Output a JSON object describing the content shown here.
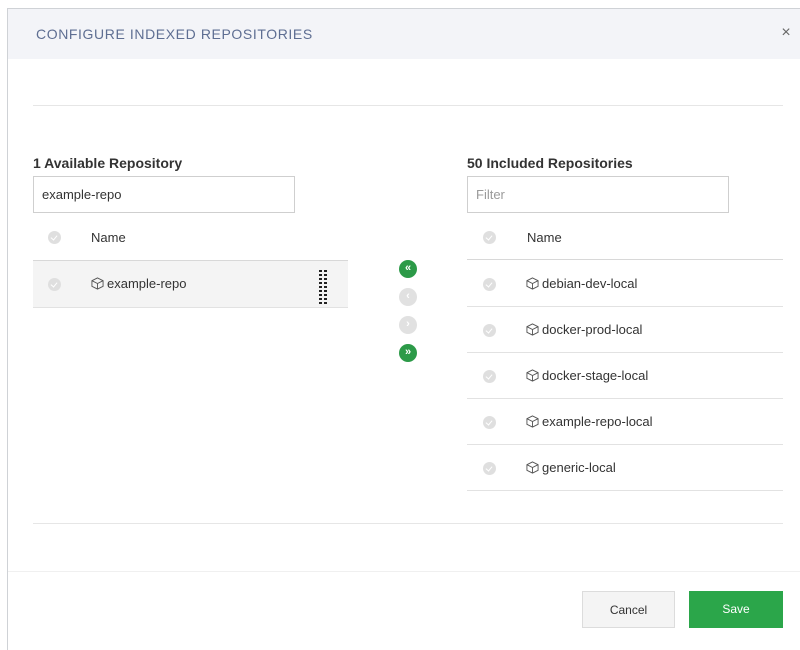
{
  "dialog": {
    "title": "CONFIGURE INDEXED REPOSITORIES",
    "close_glyph": "×"
  },
  "available": {
    "title": "1 Available Repository",
    "search_value": "example-repo",
    "column_name": "Name",
    "items": [
      {
        "label": "example-repo",
        "icon": "package-icon"
      }
    ]
  },
  "included": {
    "title": "50 Included Repositories",
    "filter_placeholder": "Filter",
    "column_name": "Name",
    "items": [
      {
        "label": "debian-dev-local",
        "icon": "package-icon"
      },
      {
        "label": "docker-prod-local",
        "icon": "package-icon"
      },
      {
        "label": "docker-stage-local",
        "icon": "package-icon"
      },
      {
        "label": "example-repo-local",
        "icon": "package-icon"
      },
      {
        "label": "generic-local",
        "icon": "package-icon"
      }
    ]
  },
  "transfer": {
    "move_all_left": "«",
    "move_left": "‹",
    "move_right": "›",
    "move_all_right": "»"
  },
  "footer": {
    "cancel_label": "Cancel",
    "save_label": "Save"
  },
  "colors": {
    "accent_green": "#2ba64a",
    "header_bg": "#f3f4f8",
    "title_color": "#5e6e92"
  }
}
